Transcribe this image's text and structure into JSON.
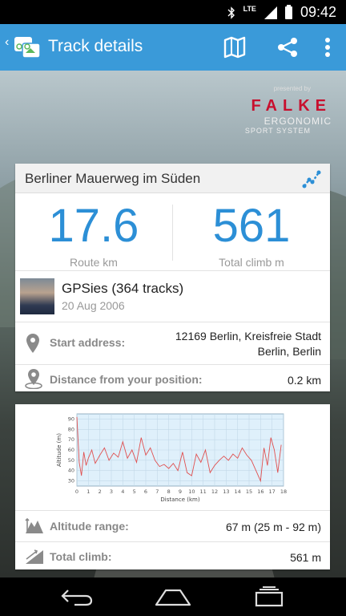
{
  "status_bar": {
    "time": "09:42",
    "network": "LTE",
    "icons": [
      "bluetooth-icon",
      "signal-icon",
      "battery-icon"
    ]
  },
  "action_bar": {
    "title": "Track details",
    "icons": [
      "map-icon",
      "share-icon",
      "overflow-menu-icon"
    ],
    "color": "#3a9ad9"
  },
  "ad": {
    "presented": "presented by",
    "brand": "FALKE",
    "line1": "ERGONOMIC",
    "line2": "SPORT SYSTEM",
    "brand_color": "#c8102e"
  },
  "track": {
    "name": "Berliner Mauerweg im Süden",
    "route_value": "17.6",
    "route_label": "Route km",
    "climb_value": "561",
    "climb_label": "Total climb m",
    "author": "GPSies (364 tracks)",
    "date": "20 Aug 2006",
    "start_label": "Start address:",
    "start_line1": "12169 Berlin, Kreisfreie Stadt",
    "start_line2": "Berlin, Berlin",
    "dist_label": "Distance from your position:",
    "dist_value": "0.2 km"
  },
  "profile": {
    "alt_label": "Altitude range:",
    "alt_value": "67 m (25 m - 92 m)",
    "climb_label": "Total climb:",
    "climb_value": "561 m"
  },
  "chart_data": {
    "type": "line",
    "title": "",
    "xlabel": "Distance (km)",
    "ylabel": "Altitude (m)",
    "xlim": [
      0,
      18
    ],
    "ylim": [
      25,
      95
    ],
    "x_ticks": [
      "0",
      "1",
      "2",
      "3",
      "4",
      "5",
      "6",
      "7",
      "8",
      "9",
      "10",
      "11",
      "12",
      "13",
      "14",
      "15",
      "16",
      "17",
      "18"
    ],
    "y_ticks": [
      "30",
      "40",
      "50",
      "60",
      "70",
      "80",
      "90"
    ],
    "grid": true,
    "line_color": "#e05050",
    "series": [
      {
        "x": [
          0,
          0.2,
          0.4,
          0.6,
          0.8,
          1,
          1.3,
          1.6,
          2,
          2.4,
          2.8,
          3.2,
          3.6,
          4,
          4.4,
          4.8,
          5.2,
          5.6,
          6,
          6.4,
          6.8,
          7.2,
          7.6,
          8,
          8.4,
          8.8,
          9.2,
          9.6,
          10,
          10.4,
          10.8,
          11.2,
          11.6,
          12,
          12.4,
          12.8,
          13.2,
          13.6,
          14,
          14.4,
          14.8,
          15.2,
          15.6,
          16,
          16.3,
          16.6,
          16.9,
          17.2,
          17.5,
          17.8
        ],
        "y": [
          92,
          48,
          35,
          58,
          45,
          52,
          60,
          47,
          55,
          62,
          50,
          57,
          53,
          68,
          52,
          60,
          48,
          72,
          55,
          62,
          50,
          44,
          46,
          42,
          47,
          40,
          58,
          38,
          35,
          56,
          48,
          60,
          38,
          45,
          50,
          54,
          50,
          56,
          52,
          62,
          55,
          50,
          40,
          30,
          62,
          45,
          72,
          60,
          38,
          65
        ]
      }
    ]
  },
  "nav": {
    "icons": [
      "back-icon",
      "home-icon",
      "recents-icon"
    ]
  }
}
